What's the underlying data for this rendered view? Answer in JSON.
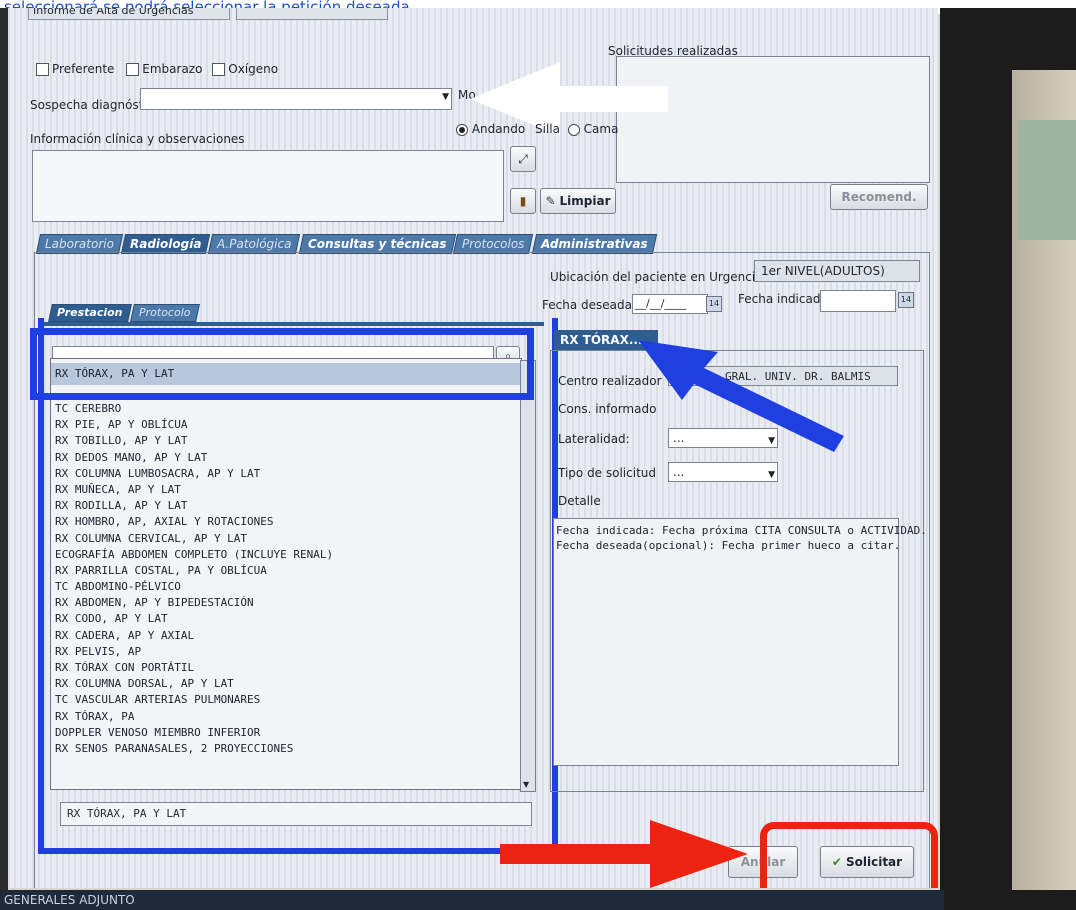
{
  "caption": "seleccionará se podrá seleccionar la petición deseada.",
  "top_tabs": [
    "Informe de Alta de Urgencias"
  ],
  "checkboxes": [
    "Preferente",
    "Embarazo",
    "Oxígeno"
  ],
  "solicitudes_label": "Solicitudes realizadas",
  "sospecha_label": "Sospecha diagnóstica",
  "movilidad_label": "Mo",
  "radio_options": [
    "Andando",
    "Silla",
    "Cama"
  ],
  "info_label": "Información clínica y observaciones",
  "limpiar_label": "Limpiar",
  "recomend_label": "Recomend.",
  "tabs": [
    "Laboratorio",
    "Radiología",
    "A.Patológica",
    "Consultas y técnicas",
    "Protocolos",
    "Administrativas"
  ],
  "ubicacion_label": "Ubicación del paciente en Urgencias",
  "ubicacion_value": "1er NIVEL(ADULTOS)",
  "fecha_deseada_label": "Fecha deseada",
  "fecha_deseada_value": "__/__/____",
  "fecha_indicada_label": "Fecha indicada",
  "calendar_icon_text": "14",
  "sub_tabs": [
    "Prestacion",
    "Protocolo"
  ],
  "search_value": "",
  "selected_prestacion": "RX TÓRAX, PA Y LAT",
  "prestaciones": [
    "TC CEREBRO",
    "RX PIE, AP Y OBLÍCUA",
    "RX TOBILLO, AP Y LAT",
    "RX DEDOS MANO, AP Y LAT",
    "RX COLUMNA LUMBOSACRA, AP Y LAT",
    "RX MUÑECA, AP Y LAT",
    "RX RODILLA, AP Y LAT",
    "RX HOMBRO, AP, AXIAL Y ROTACIONES",
    "RX COLUMNA CERVICAL, AP Y LAT",
    "ECOGRAFÍA ABDOMEN COMPLETO (INCLUYE RENAL)",
    "RX PARRILLA COSTAL, PA Y OBLÍCUA",
    "TC ABDOMINO-PÉLVICO",
    "RX ABDOMEN, AP Y BIPEDESTACIÓN",
    "RX CODO, AP Y LAT",
    "RX CADERA, AP Y AXIAL",
    "RX PELVIS, AP",
    "RX TÓRAX CON PORTÁTIL",
    "RX COLUMNA DORSAL, AP Y LAT",
    "TC VASCULAR ARTERIAS PULMONARES",
    "RX TÓRAX, PA",
    "DOPPLER VENOSO MIEMBRO INFERIOR",
    "RX SENOS PARANASALES, 2 PROYECCIONES"
  ],
  "bottom_selected": "RX TÓRAX, PA Y LAT",
  "detail_tab": "RX TÓRAX...",
  "centro_label": "Centro realizador",
  "centro_value": "GRAL. UNIV. DR. BALMIS",
  "cons_label": "Cons. informado",
  "lateralidad_label": "Lateralidad:",
  "lateralidad_value": "...",
  "tipo_label": "Tipo de solicitud",
  "tipo_value": "...",
  "detalle_label": "Detalle",
  "detalle_lines": [
    "Fecha indicada: Fecha próxima CITA CONSULTA o ACTIVIDAD.",
    "Fecha deseada(opcional): Fecha primer hueco a citar."
  ],
  "anular_label": "Anular",
  "solicitar_label": "Solicitar",
  "status_text": "GENERALES   ADJUNTO",
  "colors": {
    "blue_highlight": "#1f3fe0",
    "red_highlight": "#ee2211",
    "tab_blue": "#2f5d8f"
  }
}
